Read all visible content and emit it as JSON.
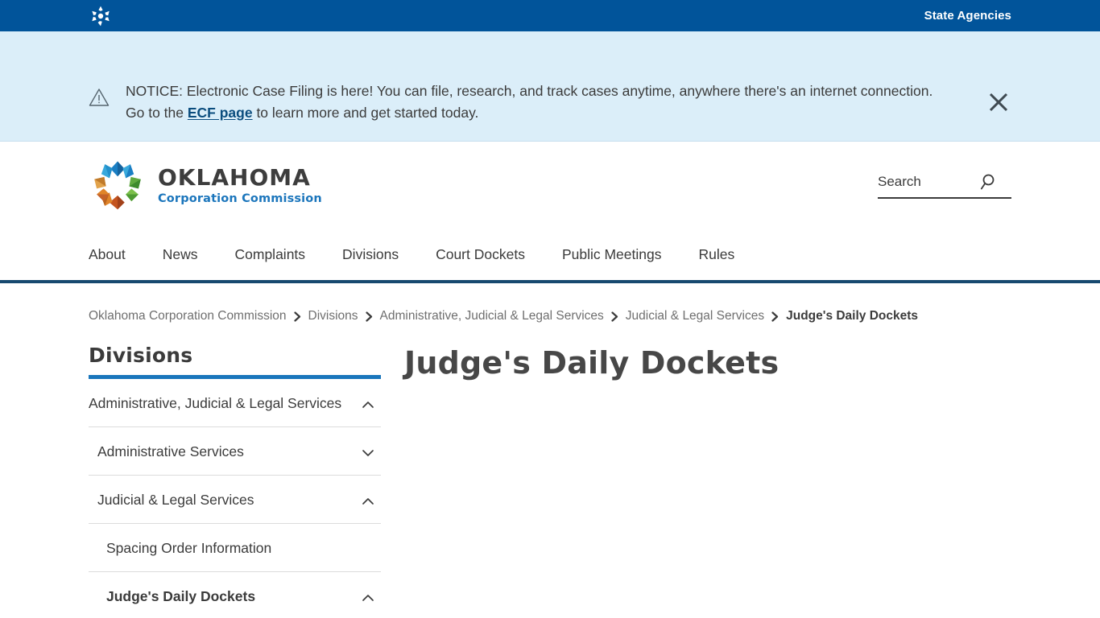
{
  "topbar": {
    "seal_icon": "oklahoma-state-seal-icon",
    "state_agencies_label": "State Agencies"
  },
  "notice": {
    "icon": "warning-triangle-icon",
    "text_before_link": "NOTICE: Electronic Case Filing is here! You can file, research, and track cases anytime, anywhere there's an internet connection. Go to the ",
    "link_label": "ECF page",
    "text_after_link": " to learn more and get started today.",
    "close_icon": "close-icon",
    "background_color": "#dbeef9"
  },
  "header": {
    "logo_icon": "oklahoma-corporation-commission-logo",
    "logo_title": "OKLAHOMA",
    "logo_subtitle": "Corporation Commission",
    "search": {
      "placeholder": "Search",
      "value": "",
      "icon": "search-icon"
    }
  },
  "mainnav": {
    "items": [
      {
        "label": "About"
      },
      {
        "label": "News"
      },
      {
        "label": "Complaints"
      },
      {
        "label": "Divisions"
      },
      {
        "label": "Court Dockets"
      },
      {
        "label": "Public Meetings"
      },
      {
        "label": "Rules"
      }
    ]
  },
  "breadcrumb": {
    "separator": "›",
    "items": [
      {
        "label": "Oklahoma Corporation Commission",
        "current": false
      },
      {
        "label": "Divisions",
        "current": false
      },
      {
        "label": "Administrative, Judicial & Legal Services",
        "current": false
      },
      {
        "label": "Judicial & Legal Services",
        "current": false
      },
      {
        "label": "Judge's Daily Dockets",
        "current": true
      }
    ]
  },
  "sidebar": {
    "title": "Divisions",
    "accent_color": "#1a76bc",
    "items": [
      {
        "label": "Administrative, Judicial & Legal Services",
        "level": 1,
        "chevron": "chevron-up-icon",
        "expanded": true,
        "active": false
      },
      {
        "label": "Administrative Services",
        "level": 2,
        "chevron": "chevron-down-icon",
        "expanded": false,
        "active": false
      },
      {
        "label": "Judicial & Legal Services",
        "level": 2,
        "chevron": "chevron-up-icon",
        "expanded": true,
        "active": false
      },
      {
        "label": "Spacing Order Information",
        "level": 3,
        "chevron": "none",
        "expanded": false,
        "active": false
      },
      {
        "label": "Judge's Daily Dockets",
        "level": 3,
        "chevron": "chevron-up-icon",
        "expanded": true,
        "active": true
      }
    ]
  },
  "main": {
    "page_title": "Judge's Daily Dockets"
  },
  "colors": {
    "topbar_blue": "#01549a",
    "nav_border": "#17496f",
    "link_blue": "#0b4d7e",
    "sidebar_accent": "#1a76bc",
    "text": "#3b3b3b"
  }
}
